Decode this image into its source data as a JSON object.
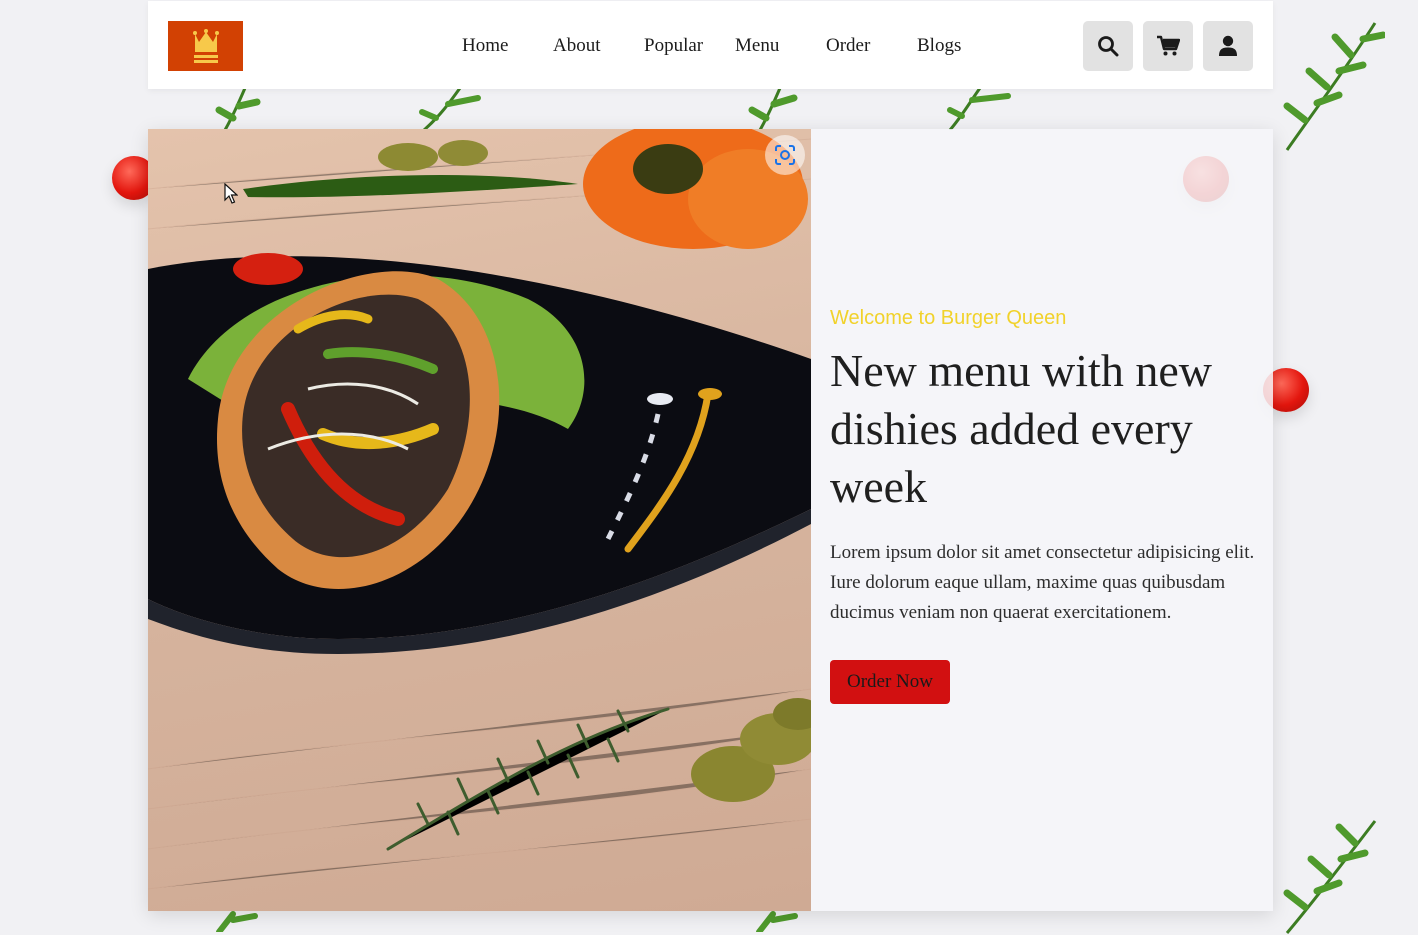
{
  "brand": {
    "logo_icon": "crown-logo-icon",
    "logo_color": "#d24103"
  },
  "nav": {
    "items": [
      {
        "label": "Home"
      },
      {
        "label": "About"
      },
      {
        "label": "Popular"
      },
      {
        "label": "Menu"
      },
      {
        "label": "Order"
      },
      {
        "label": "Blogs"
      }
    ]
  },
  "header_actions": [
    {
      "icon": "search-icon"
    },
    {
      "icon": "cart-icon"
    },
    {
      "icon": "user-icon"
    }
  ],
  "hero": {
    "image_icon": "food-photo",
    "lens_icon": "visual-search-icon",
    "welcome": "Welcome to Burger Queen",
    "headline": "New menu with new dishies added every week",
    "description": "Lorem ipsum dolor sit amet consectetur adipisicing elit. Iure dolorum eaque ullam, maxime quas quibusdam ducimus veniam non quaerat exercitationem.",
    "cta_label": "Order Now"
  },
  "colors": {
    "accent_yellow": "#f1d22b",
    "cta_red": "#d21011",
    "icon_bg": "#e2e2e2"
  }
}
